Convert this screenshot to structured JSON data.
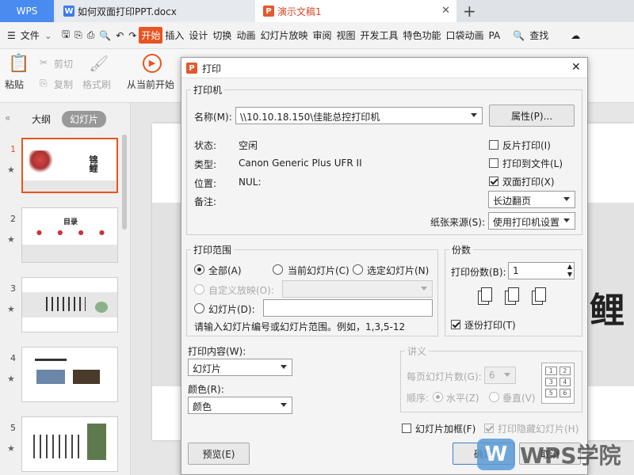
{
  "tabs": {
    "wps": "WPS",
    "doc": "如何双面打印PPT.docx",
    "ppt": "演示文稿1"
  },
  "menu": {
    "file": "文件",
    "items": [
      "开始",
      "插入",
      "设计",
      "切换",
      "动画",
      "幻灯片放映",
      "审阅",
      "视图",
      "开发工具",
      "特色功能",
      "口袋动画",
      "PA"
    ],
    "search": "查找"
  },
  "ribbon": {
    "paste": "粘贴",
    "cut": "剪切",
    "copy": "复制",
    "format_painter": "格式刷",
    "from_current": "从当前开始"
  },
  "left_panel": {
    "outline": "大纲",
    "slides": "幻灯片",
    "slide_numbers": [
      "1",
      "2",
      "3",
      "4",
      "5"
    ],
    "thumb1_title": "锦鲤",
    "thumb2_title": "目录"
  },
  "slide": {
    "char": "鲤"
  },
  "dialog": {
    "title": "打印",
    "printer_group": "打印机",
    "name_label": "名称(M):",
    "printer_name": "\\\\10.10.18.150\\佳能总控打印机",
    "properties_button": "属性(P)...",
    "status_label": "状态:",
    "status_value": "空闲",
    "type_label": "类型:",
    "type_value": "Canon Generic Plus UFR II",
    "location_label": "位置:",
    "location_value": "NUL:",
    "comment_label": "备注:",
    "reverse_print": "反片打印(I)",
    "print_to_file": "打印到文件(L)",
    "duplex_print": "双面打印(X)",
    "duplex_mode": "长边翻页",
    "paper_source_label": "纸张来源(S):",
    "paper_source_value": "使用打印机设置",
    "range_group": "打印范围",
    "range_all": "全部(A)",
    "range_current": "当前幻灯片(C)",
    "range_selected": "选定幻灯片(N)",
    "range_custom": "自定义放映(O):",
    "range_slides": "幻灯片(D):",
    "range_hint": "请输入幻灯片编号或幻灯片范围。例如，1,3,5-12",
    "copies_group": "份数",
    "copies_label": "打印份数(B):",
    "copies_value": "1",
    "collate": "逐份打印(T)",
    "content_label": "打印内容(W):",
    "content_value": "幻灯片",
    "color_label": "颜色(R):",
    "color_value": "颜色",
    "handout_group": "讲义",
    "per_page_label": "每页幻灯片数(G):",
    "per_page_value": "6",
    "order_label": "顺序:",
    "order_horizontal": "水平(Z)",
    "order_vertical": "垂直(V)",
    "frame_slides": "幻灯片加框(F)",
    "print_hidden": "打印隐藏幻灯片(H)",
    "preview_button": "预览(E)",
    "ok_button": "确定",
    "cancel_button": "取消"
  },
  "watermark": {
    "text": "WPS学院"
  },
  "colors": {
    "accent": "#e8541f",
    "tab_blue": "#4a8bf0"
  }
}
